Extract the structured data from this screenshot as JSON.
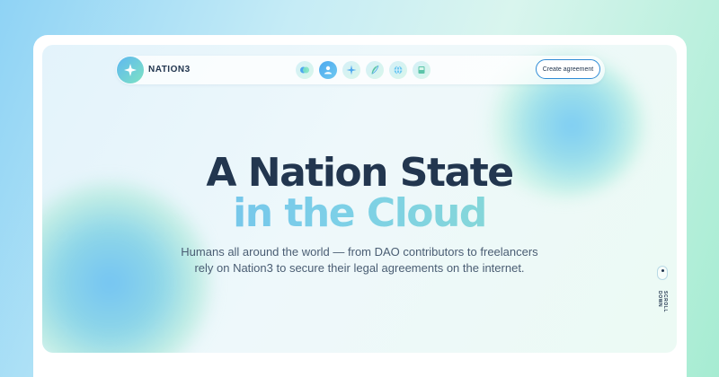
{
  "brand": {
    "name": "NATION3",
    "logo_icon": "sparkle-star-icon"
  },
  "nav": {
    "icons": [
      "coin-icon",
      "user-icon",
      "sparkle-icon",
      "feather-icon",
      "globe-icon",
      "book-icon"
    ],
    "active_index": 1,
    "cta_label": "Create agreement"
  },
  "hero": {
    "title_line1": "A Nation State",
    "title_line2": "in the Cloud",
    "subtitle_line1": "Humans all around the world — from DAO contributors to freelancers",
    "subtitle_line2": "rely on Nation3 to secure their legal agreements on the internet."
  },
  "scroll": {
    "label": "SCROLL DOWN"
  },
  "colors": {
    "navy": "#22364f",
    "accent_blue": "#2e8bd6",
    "gradient_start": "#6bb8ef",
    "gradient_end": "#8fe0c8"
  }
}
